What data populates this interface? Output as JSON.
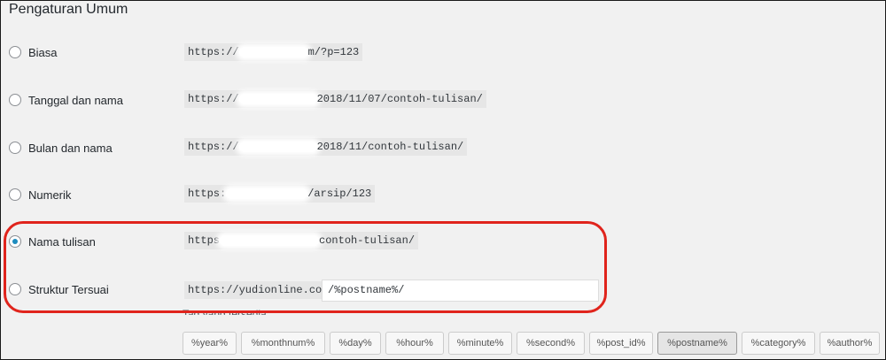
{
  "section_title": "Pengaturan Umum",
  "options": [
    {
      "label": "Biasa",
      "url_prefix": "https://",
      "url_suffix": "m/?p=123",
      "checked": false
    },
    {
      "label": "Tanggal dan nama",
      "url_prefix": "https://",
      "url_suffix": "2018/11/07/contoh-tulisan/",
      "checked": false
    },
    {
      "label": "Bulan dan nama",
      "url_prefix": "https://",
      "url_suffix": "2018/11/contoh-tulisan/",
      "checked": false
    },
    {
      "label": "Numerik",
      "url_prefix": "https:",
      "url_suffix": "/arsip/123",
      "checked": false
    },
    {
      "label": "Nama tulisan",
      "url_prefix": "https",
      "url_suffix": "contoh-tulisan/",
      "checked": true
    },
    {
      "label": "Struktur Tersuai",
      "url_prefix": "https://yudionline.com",
      "url_suffix": "",
      "checked": false
    }
  ],
  "custom_structure_value": "/%postname%/",
  "available_tags_label": "Tag yang tersedia:",
  "tags": [
    "%year%",
    "%monthnum%",
    "%day%",
    "%hour%",
    "%minute%",
    "%second%",
    "%post_id%",
    "%postname%",
    "%category%",
    "%author%"
  ],
  "active_tag": "%postname%",
  "colors": {
    "highlight": "#e0241c",
    "radio_checked": "#1e8cbe"
  }
}
